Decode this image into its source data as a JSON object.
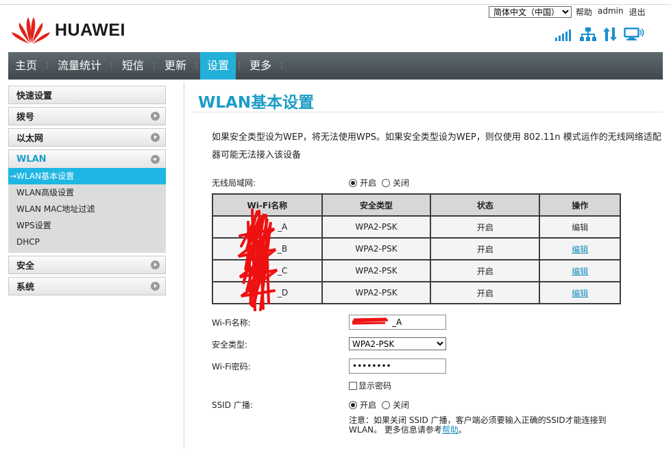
{
  "header": {
    "brand": "HUAWEI",
    "language": "简体中文（中国）",
    "links": [
      "帮助",
      "admin",
      "退出"
    ]
  },
  "icons": {
    "signal": "signal-strength-icon",
    "network": "network-icon",
    "transfer": "data-transfer-icon",
    "computer": "computer-icon"
  },
  "nav": {
    "items": [
      "主页",
      "流量统计",
      "短信",
      "更新",
      "设置",
      "更多"
    ],
    "active": "设置"
  },
  "sidebar": {
    "quick": "快速设置",
    "dialup": "拨号",
    "ethernet": "以太网",
    "wlan": "WLAN",
    "wlan_items": [
      "→WLAN基本设置",
      "WLAN高级设置",
      "WLAN MAC地址过滤",
      "WPS设置",
      "DHCP"
    ],
    "security": "安全",
    "system": "系统"
  },
  "main": {
    "title": "WLAN基本设置",
    "notice": "如果安全类型设为WEP，将无法使用WPS。如果安全类型设为WEP，则仅使用 802.11n 模式运作的无线网络适配器可能无法接入该设备",
    "wlan_label": "无线局域网:",
    "radio_on": "开启",
    "radio_off": "关闭",
    "table": {
      "headers": [
        "Wi-Fi名称",
        "安全类型",
        "状态",
        "操作"
      ],
      "rows": [
        {
          "ssid": "_A",
          "security": "WPA2-PSK",
          "status": "开启",
          "action": "编辑",
          "link": false
        },
        {
          "ssid": "_B",
          "security": "WPA2-PSK",
          "status": "开启",
          "action": "编辑",
          "link": true
        },
        {
          "ssid": "_C",
          "security": "WPA2-PSK",
          "status": "开启",
          "action": "编辑",
          "link": true
        },
        {
          "ssid": "_D",
          "security": "WPA2-PSK",
          "status": "开启",
          "action": "编辑",
          "link": true
        }
      ]
    },
    "ssid_label": "Wi-Fi名称:",
    "ssid_value": "_A",
    "security_label": "安全类型:",
    "security_value": "WPA2-PSK",
    "password_label": "Wi-Fi密码:",
    "password_value": "••••••••",
    "show_password": "显示密码",
    "broadcast_label": "SSID 广播:",
    "note_text": "注意：如果关闭 SSID 广播，客户端必须要输入正确的SSID才能连接到 WLAN。 更多信息请参考",
    "note_link": "帮助",
    "note_end": "。"
  },
  "colors": {
    "accent": "#23b0d8",
    "title": "#1d9cc6",
    "nav_bg": "#4a5358",
    "brand_red": "#e2231a",
    "icon_blue": "#1a8fd0"
  }
}
